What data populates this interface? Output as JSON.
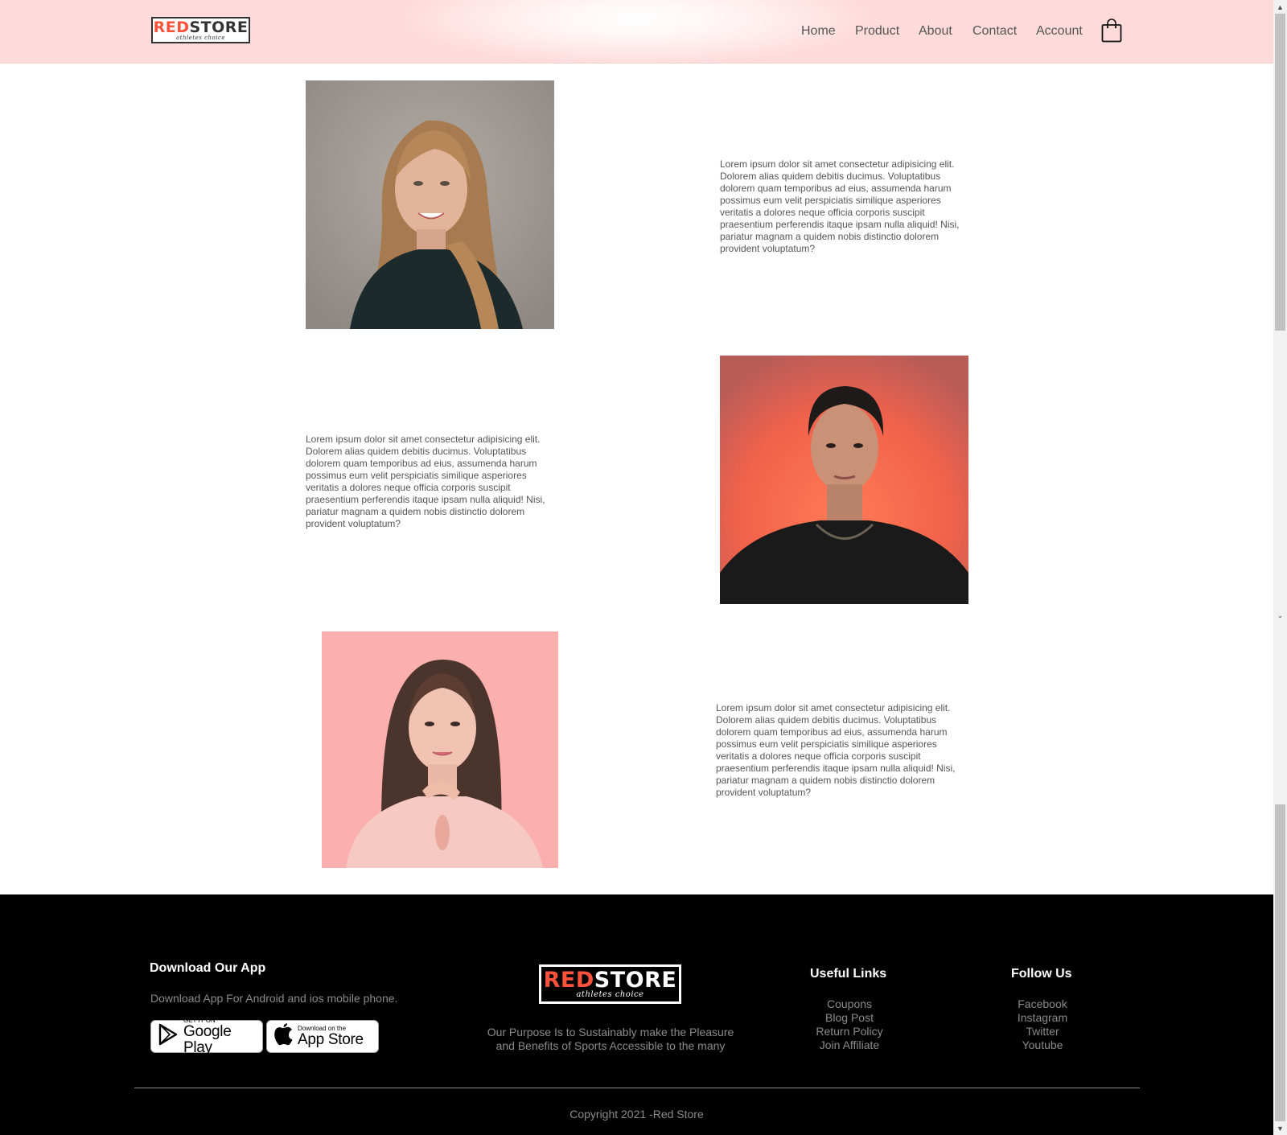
{
  "brand": {
    "logo_main_red": "RED",
    "logo_main_dark": "STORE",
    "logo_sub": "athletes choice"
  },
  "nav": {
    "items": [
      "Home",
      "Product",
      "About",
      "Contact",
      "Account"
    ],
    "cart_icon": "shopping-bag-icon"
  },
  "testimonials": [
    {
      "text": "Lorem ipsum dolor sit amet consectetur adipisicing elit. Dolorem alias quidem debitis ducimus. Voluptatibus dolorem quam temporibus ad eius, assumenda harum possimus eum velit perspiciatis similique asperiores veritatis a dolores neque officia corporis suscipit praesentium perferendis itaque ipsam nulla aliquid! Nisi, pariatur magnam a quidem nobis distinctio dolorem provident voluptatum?",
      "photo": "woman-blonde-portrait"
    },
    {
      "text": "Lorem ipsum dolor sit amet consectetur adipisicing elit. Dolorem alias quidem debitis ducimus. Voluptatibus dolorem quam temporibus ad eius, assumenda harum possimus eum velit perspiciatis similique asperiores veritatis a dolores neque officia corporis suscipit praesentium perferendis itaque ipsam nulla aliquid! Nisi, pariatur magnam a quidem nobis distinctio dolorem provident voluptatum?",
      "photo": "man-portrait"
    },
    {
      "text": "Lorem ipsum dolor sit amet consectetur adipisicing elit. Dolorem alias quidem debitis ducimus. Voluptatibus dolorem quam temporibus ad eius, assumenda harum possimus eum velit perspiciatis similique asperiores veritatis a dolores neque officia corporis suscipit praesentium perferendis itaque ipsam nulla aliquid! Nisi, pariatur magnam a quidem nobis distinctio dolorem provident voluptatum?",
      "photo": "woman-brunette-portrait"
    }
  ],
  "footer": {
    "download_title": "Download Our App",
    "download_text": "Download App For Android and ios mobile phone.",
    "google_play": {
      "small": "GET IT ON",
      "big": "Google Play"
    },
    "app_store": {
      "small": "Download on the",
      "big": "App Store"
    },
    "purpose_line1": "Our Purpose Is to Sustainably make the Pleasure",
    "purpose_line2": "and Benefits of Sports Accessible to the many",
    "useful_links_title": "Useful Links",
    "useful_links": [
      "Coupons",
      "Blog Post",
      "Return Policy",
      "Join Affiliate"
    ],
    "follow_title": "Follow Us",
    "follow_links": [
      "Facebook",
      "Instagram",
      "Twitter",
      "Youtube"
    ],
    "copyright": "Copyright 2021 -Red Store"
  },
  "colors": {
    "accent": "#ff523b",
    "header_tint": "#ffdada",
    "text": "#555555",
    "footer_bg": "#000000"
  }
}
